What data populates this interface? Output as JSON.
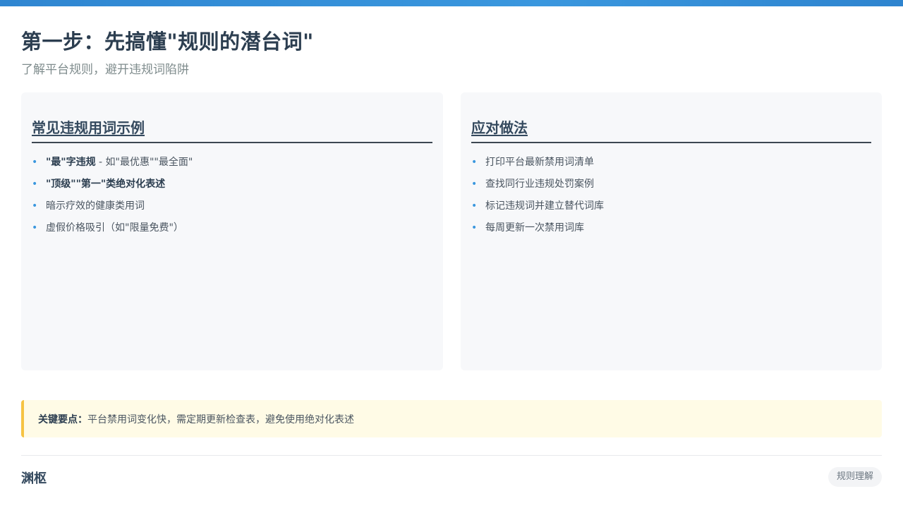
{
  "header": {
    "title": "第一步：先搞懂\"规则的潜台词\"",
    "subtitle": "了解平台规则，避开违规词陷阱"
  },
  "cards": {
    "left": {
      "heading": "常见违规用词示例",
      "items": [
        {
          "bold": "\"最\"字违规",
          "text": " - 如\"最优惠\"\"最全面\""
        },
        {
          "bold": "\"顶级\"\"第一\"类绝对化表述",
          "text": ""
        },
        {
          "bold": "",
          "text": "暗示疗效的健康类用词"
        },
        {
          "bold": "",
          "text": "虚假价格吸引（如\"限量免费\"）"
        }
      ]
    },
    "right": {
      "heading": "应对做法",
      "items": [
        {
          "text": "打印平台最新禁用词清单"
        },
        {
          "text": "查找同行业违规处罚案例"
        },
        {
          "text": "标记违规词并建立替代词库"
        },
        {
          "text": "每周更新一次禁用词库"
        }
      ]
    }
  },
  "keypoint": {
    "label": "关键要点：",
    "text": "平台禁用词变化快，需定期更新检查表，避免使用绝对化表述"
  },
  "footer": {
    "brand": "渊枢",
    "tag": "规则理解"
  },
  "colors": {
    "accent": "#3a97de",
    "highlight_border": "#f6c343",
    "highlight_bg": "#fffbe6"
  }
}
